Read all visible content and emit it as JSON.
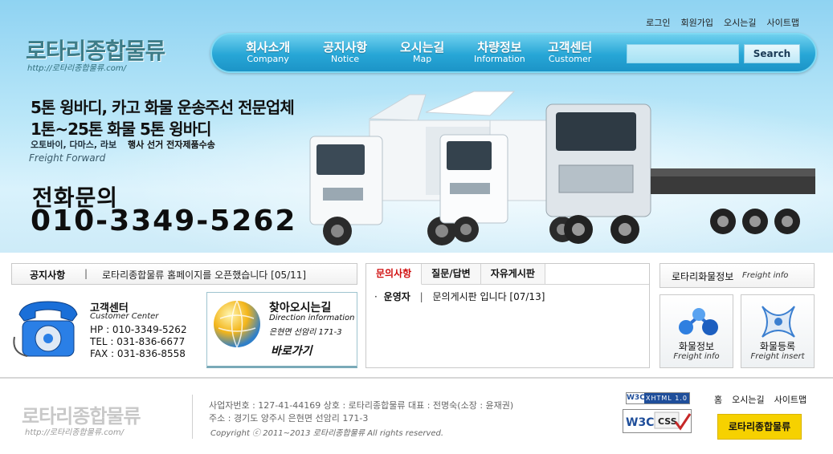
{
  "util_links": [
    "로그인",
    "회원가입",
    "오시는길",
    "사이트맵"
  ],
  "logo": {
    "text": "로타리종합물류",
    "url": "http://로타리종합물류.com/"
  },
  "nav": {
    "items": [
      {
        "ko": "회사소개",
        "en": "Company"
      },
      {
        "ko": "공지사항",
        "en": "Notice"
      },
      {
        "ko": "오시는길",
        "en": "Map"
      },
      {
        "ko": "차량정보",
        "en": "Information"
      },
      {
        "ko": "고객센터",
        "en": "Customer"
      }
    ],
    "search_label": "Search"
  },
  "hero": {
    "headline1": "5톤 윙바디, 카고 화물 운송주선 전문업체",
    "headline2": "1톤~25톤 화물 5톤 윙바디",
    "items": "오토바이, 다마스, 라보",
    "event": "행사 선거 전자제품수송",
    "freight_en": "Freight Forward",
    "phone_label": "전화문의",
    "phone_number": "010-3349-5262"
  },
  "notice": {
    "title": "공지사항",
    "sep": "|",
    "text": "로타리종합물류 홈페이지를 오픈했습니다 [05/11]"
  },
  "contact": {
    "title": "고객센터",
    "subtitle": "Customer Center",
    "hp": "HP : 010-3349-5262",
    "tel": "TEL : 031-836-6677",
    "fax": "FAX : 031-836-8558"
  },
  "direction": {
    "title": "찾아오시는길",
    "subtitle": "Direction information",
    "address": "은현면 선암리 171-3",
    "go": "바로가기"
  },
  "board": {
    "tabs": [
      "문의사항",
      "질문/답변",
      "자유게시판"
    ],
    "active_tab": 0,
    "row": {
      "bullet": "·",
      "author": "운영자",
      "sep": "|",
      "title": "문의게시판 입니다 [07/13]"
    }
  },
  "freight_info": {
    "header_ko": "로타리화물정보",
    "header_en": "Freight info",
    "cards": [
      {
        "ko": "화물정보",
        "en": "Freight info",
        "icon": "molecule-icon"
      },
      {
        "ko": "화물등록",
        "en": "Freight insert",
        "icon": "ribbon-icon"
      }
    ]
  },
  "footer": {
    "logo": "로타리종합물류",
    "url": "http://로타리종합물류.com/",
    "line1": "사업자번호 : 127-41-44169   상호 : 로타리종합물류   대표 : 전명숙(소장 : 윤재권)",
    "line2": "주소 : 경기도 양주시 은현면 선암리 171-3",
    "copyright": "Copyright ⓒ 2011~2013 로타리종합물류 All rights reserved.",
    "w3c_xhtml": {
      "w": "W3C",
      "x": "XHTML 1.0"
    },
    "w3c_css": "CSS",
    "links": [
      "홈",
      "오시는길",
      "사이트맵"
    ],
    "yellow_button": "로타리종합물류"
  },
  "colors": {
    "nav_blue": "#1f9bcc",
    "hero_sky": "#b8e6f8",
    "active_tab_red": "#d01010",
    "button_yellow": "#f6d100"
  }
}
